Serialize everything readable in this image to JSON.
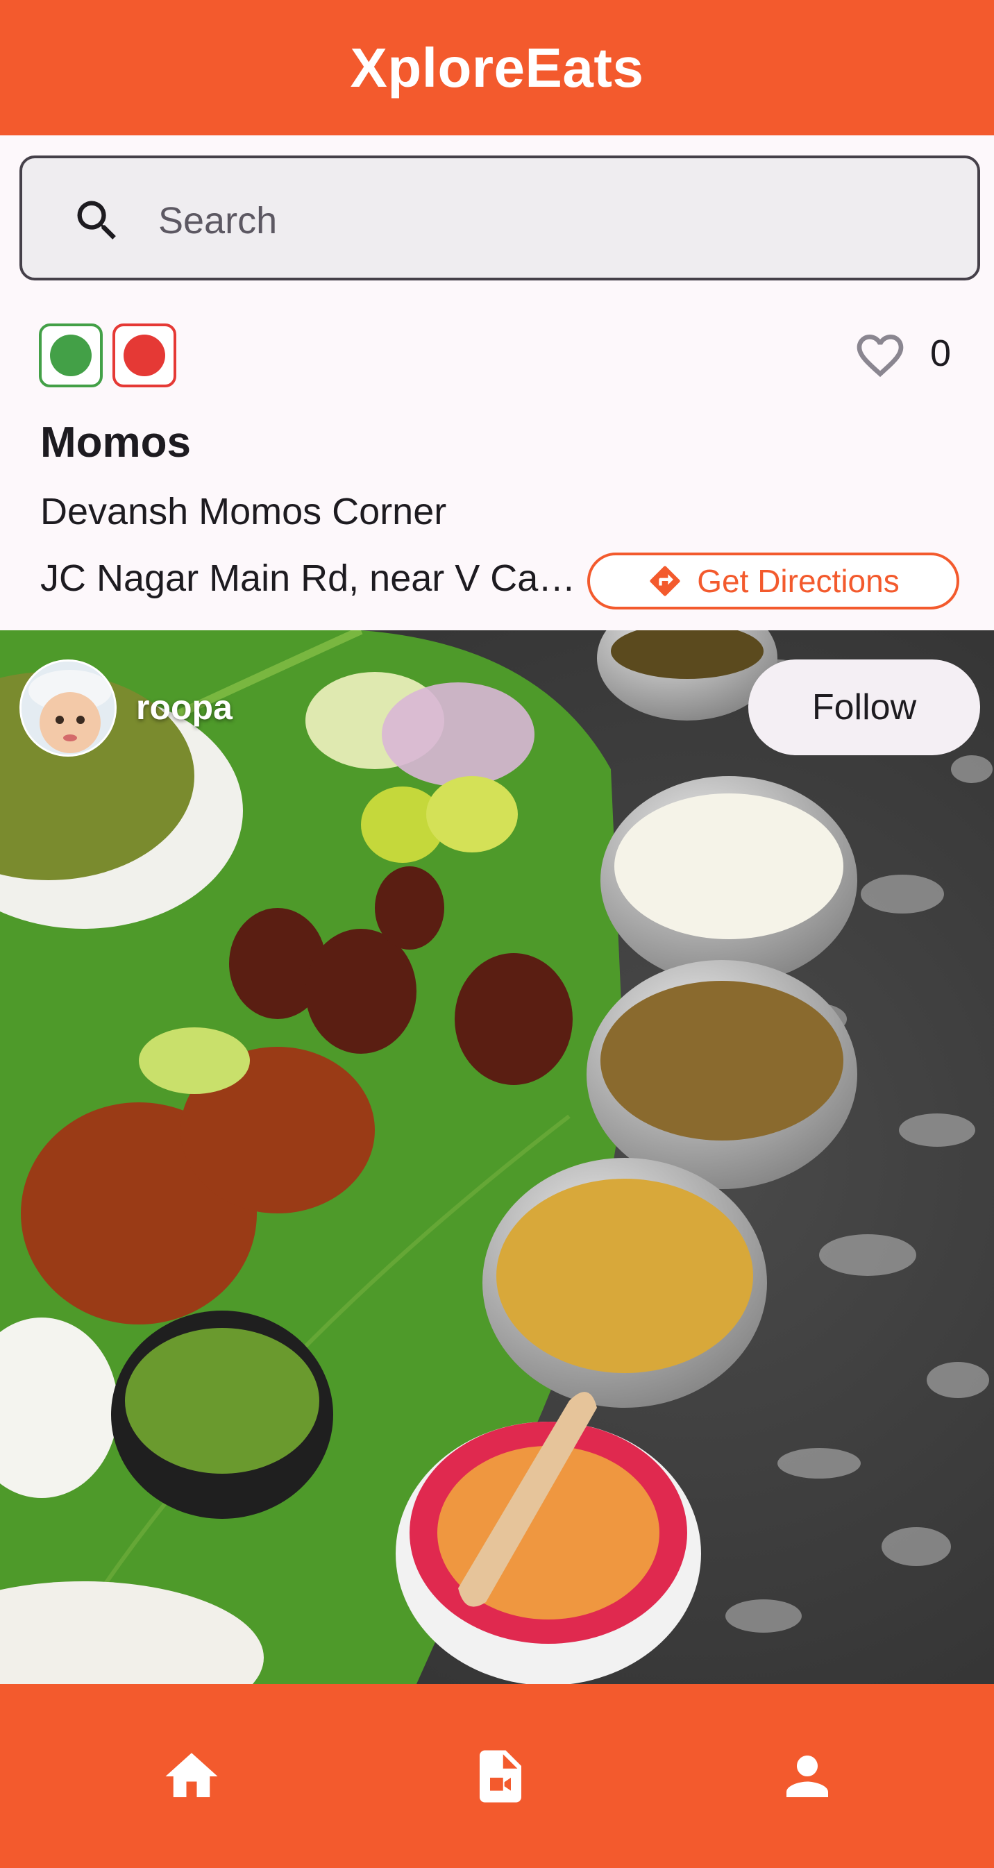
{
  "app": {
    "title": "XploreEats",
    "accent_color": "#f35a2d"
  },
  "search": {
    "placeholder": "Search",
    "value": "",
    "icon": "search-icon"
  },
  "post": {
    "veg_indicators": [
      {
        "name": "veg",
        "color": "#43a047"
      },
      {
        "name": "non-veg",
        "color": "#e53935"
      }
    ],
    "likes": "0",
    "item_name": "Momos",
    "restaurant": "Devansh Momos Corner",
    "address": "JC Nagar Main Rd, near V Cauvery",
    "directions_label": "Get Directions",
    "author": {
      "username": "roopa"
    },
    "follow_label": "Follow"
  },
  "bottom_nav": [
    {
      "icon": "home-icon"
    },
    {
      "icon": "video-file-icon"
    },
    {
      "icon": "person-icon"
    }
  ]
}
